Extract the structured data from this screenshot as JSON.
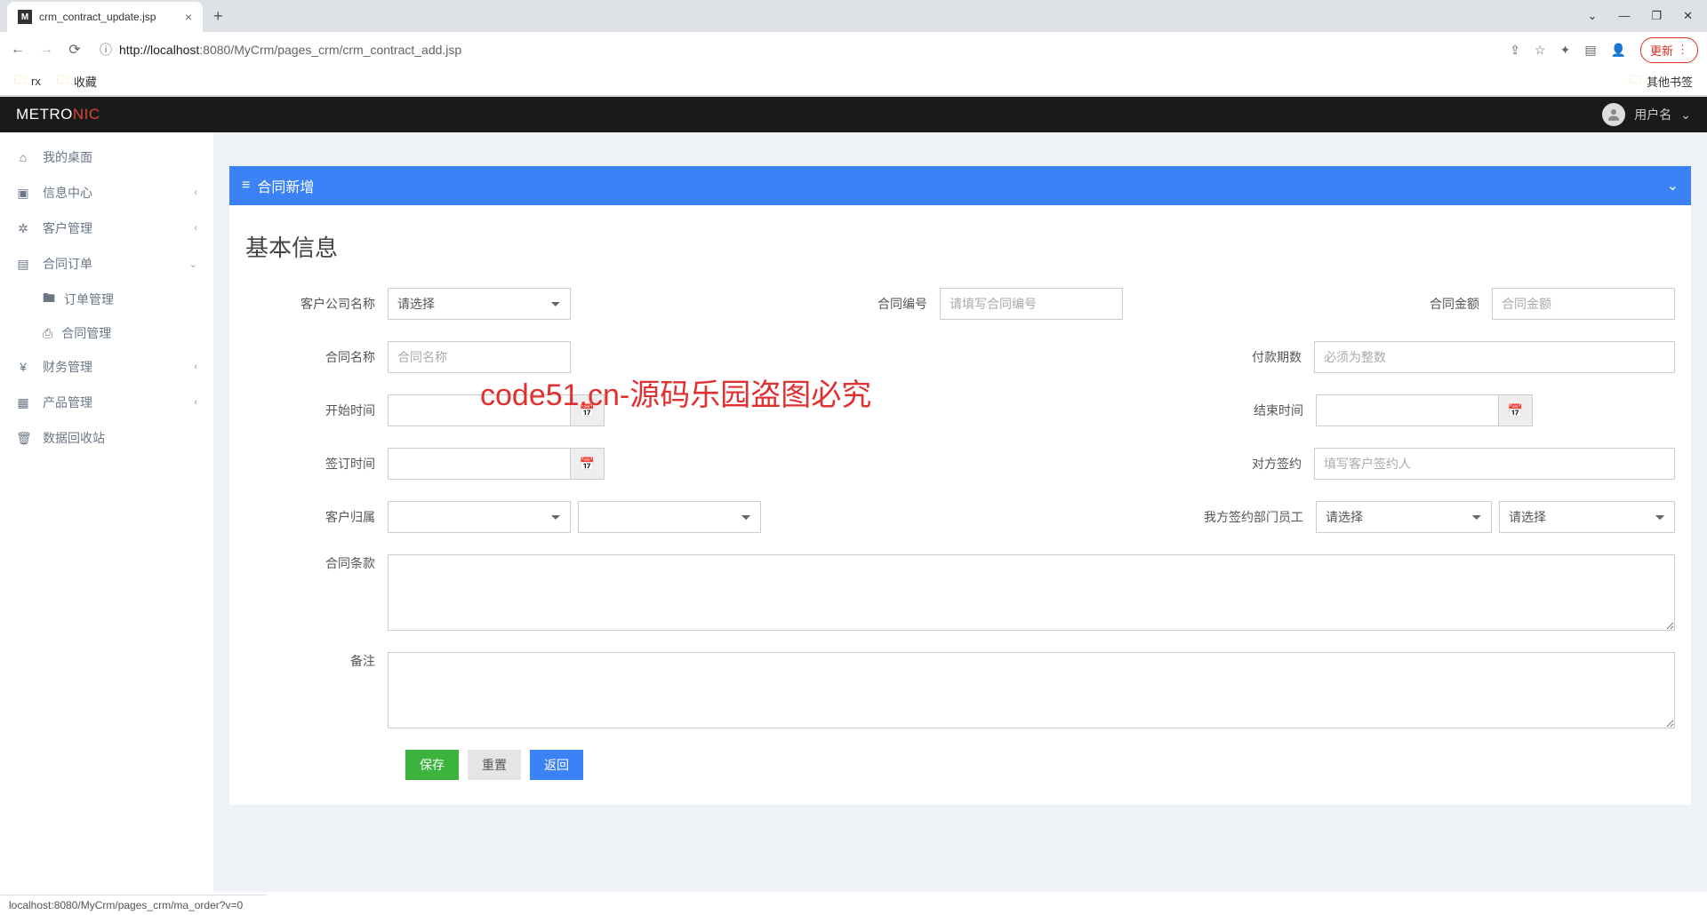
{
  "browser": {
    "tab_title": "crm_contract_update.jsp",
    "url_info_icon": "ⓘ",
    "url_prefix": "http://",
    "url_host": "localhost",
    "url_port": ":8080",
    "url_path": "/MyCrm/pages_crm/crm_contract_add.jsp",
    "update_btn": "更新",
    "bookmarks": {
      "rx": "rx",
      "fav": "收藏",
      "other": "其他书签"
    }
  },
  "header": {
    "brand_pre": "METRO",
    "brand_suf": "NIC",
    "username": "用户名"
  },
  "sidebar": {
    "desktop": "我的桌面",
    "info": "信息中心",
    "customer": "客户管理",
    "contract": "合同订单",
    "sub_order": "订单管理",
    "sub_contract": "合同管理",
    "finance": "财务管理",
    "product": "产品管理",
    "recycle": "数据回收站"
  },
  "panel": {
    "title": "合同新增",
    "section": "基本信息"
  },
  "form": {
    "company_label": "客户公司名称",
    "company_placeholder": "请选择",
    "contract_no_label": "合同编号",
    "contract_no_placeholder": "请填写合同编号",
    "amount_label": "合同金额",
    "amount_placeholder": "合同金额",
    "contract_name_label": "合同名称",
    "contract_name_placeholder": "合同名称",
    "periods_label": "付款期数",
    "periods_placeholder": "必须为整数",
    "start_label": "开始时间",
    "end_label": "结束时间",
    "sign_date_label": "签订时间",
    "counter_sign_label": "对方签约",
    "counter_sign_placeholder": "填写客户签约人",
    "owner_label": "客户归属",
    "our_dept_label": "我方签约部门员工",
    "our_dept_placeholder": "请选择",
    "our_emp_placeholder": "请选择",
    "terms_label": "合同条款",
    "remark_label": "备注"
  },
  "buttons": {
    "save": "保存",
    "reset": "重置",
    "back": "返回"
  },
  "watermark": "code51.cn-源码乐园盗图必究",
  "status_bar": "localhost:8080/MyCrm/pages_crm/ma_order?v=0"
}
